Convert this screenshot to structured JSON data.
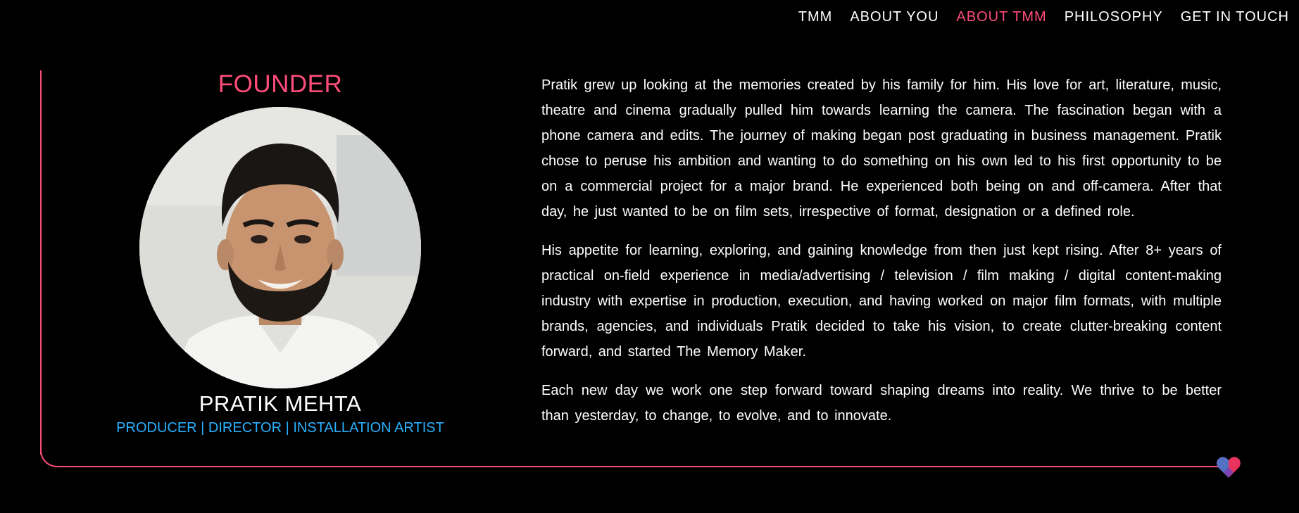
{
  "nav": {
    "items": [
      {
        "label": "TMM",
        "active": false
      },
      {
        "label": "ABOUT YOU",
        "active": false
      },
      {
        "label": "ABOUT TMM",
        "active": true
      },
      {
        "label": "PHILOSOPHY",
        "active": false
      },
      {
        "label": "GET IN TOUCH",
        "active": false
      }
    ]
  },
  "founder": {
    "title": "FOUNDER",
    "name": "PRATIK MEHTA",
    "role": "PRODUCER | DIRECTOR | INSTALLATION ARTIST"
  },
  "bio": {
    "paragraphs": [
      "Pratik grew up looking at the memories created by his family for him. His love for art, literature, music, theatre and cinema gradually pulled him towards learning the camera. The fascination began with a phone camera and edits. The journey of making began post graduating in business management. Pratik chose to peruse his ambition and wanting to do something on his own led to his first opportunity to be on a commercial project for a major brand. He experienced both being on and off-camera. After that day, he just wanted to be on film sets, irrespective of format, designation or a defined role.",
      "His appetite for learning, exploring, and gaining knowledge from then just kept rising. After 8+ years of practical on-field experience in media/advertising / television / film making / digital content-making industry with expertise in production, execution, and having worked on major film formats, with multiple brands, agencies, and individuals Pratik decided to take his vision, to create clutter-breaking content forward, and started The Memory Maker.",
      "Each new day we work one step forward toward shaping dreams into reality. We thrive to be better than yesterday, to change, to evolve, and to innovate."
    ]
  },
  "colors": {
    "accent": "#ff4d7a",
    "role_blue": "#2ab1ff",
    "background": "#000000",
    "text": "#ffffff"
  }
}
